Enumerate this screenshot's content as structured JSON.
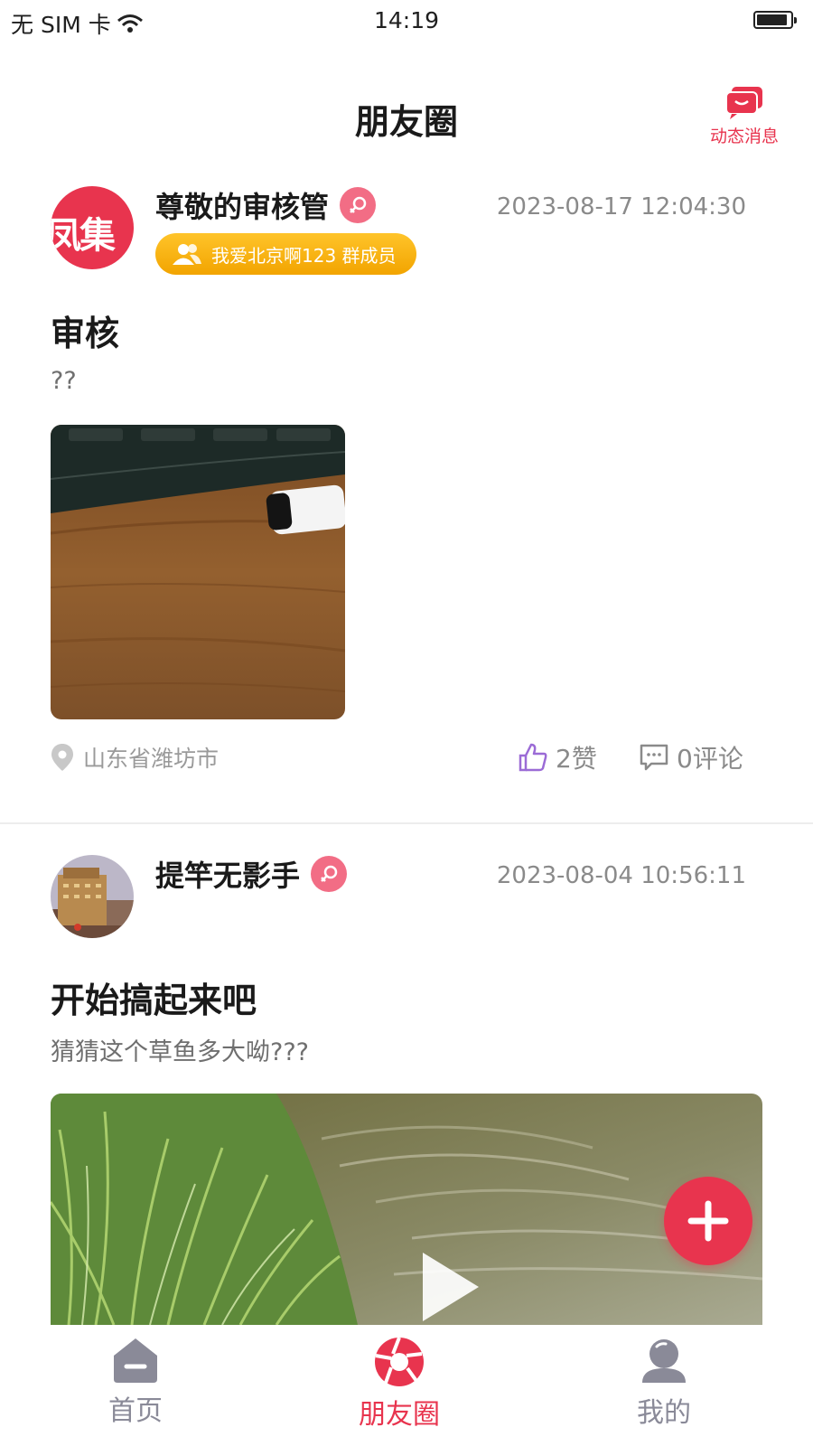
{
  "status_bar": {
    "carrier": "无 SIM 卡",
    "time": "14:19",
    "battery_level": 0.92
  },
  "header": {
    "title": "朋友圈",
    "message_button_label": "动态消息",
    "message_icon": "chat-bubble-icon"
  },
  "posts": [
    {
      "author": "尊敬的审核管",
      "avatar_text": "凤集",
      "gender_icon": "female-icon",
      "timestamp": "2023-08-17 12:04:30",
      "group_badge": "我爱北京啊123 群成员",
      "title": "审核",
      "body": "??",
      "media_type": "image",
      "location": "山东省潍坊市",
      "likes": "2赞",
      "comments": "0评论"
    },
    {
      "author": "提竿无影手",
      "gender_icon": "female-icon",
      "timestamp": "2023-08-04 10:56:11",
      "title": "开始搞起来吧",
      "body": "猜猜这个草鱼多大呦???",
      "media_type": "video"
    }
  ],
  "tabbar": {
    "items": [
      {
        "label": "首页",
        "icon": "home-icon",
        "active": false
      },
      {
        "label": "朋友圈",
        "icon": "camera-aperture-icon",
        "active": true
      },
      {
        "label": "我的",
        "icon": "profile-icon",
        "active": false
      }
    ]
  },
  "colors": {
    "accent": "#e8344e",
    "badge": "#f5b312",
    "inactive_tab": "#8a8a98"
  }
}
